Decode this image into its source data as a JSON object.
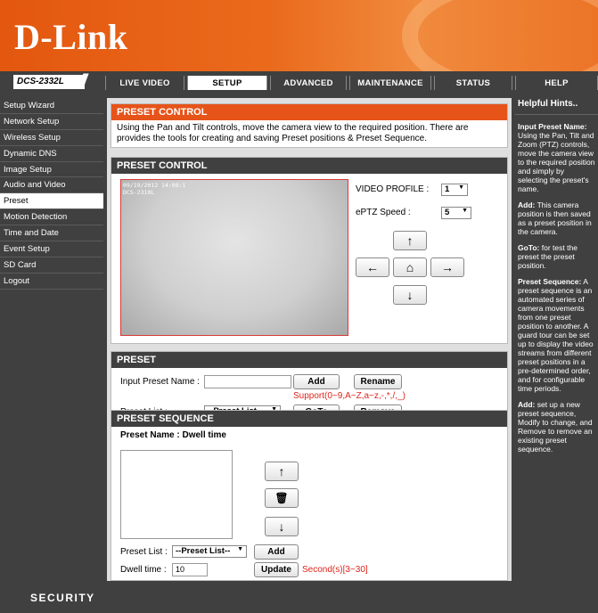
{
  "brand": {
    "logo": "D-Link",
    "model": "DCS-2332L",
    "footer": "SECURITY"
  },
  "nav": {
    "tabs": [
      "LIVE VIDEO",
      "SETUP",
      "ADVANCED",
      "MAINTENANCE",
      "STATUS",
      "HELP"
    ],
    "active": "SETUP"
  },
  "sidebar": {
    "items": [
      "Setup Wizard",
      "Network Setup",
      "Wireless Setup",
      "Dynamic DNS",
      "Image Setup",
      "Audio and Video",
      "Preset",
      "Motion Detection",
      "Time and Date",
      "Event Setup",
      "SD Card",
      "Logout"
    ],
    "active": "Preset"
  },
  "intro": {
    "title": "PRESET CONTROL",
    "text": "Using the Pan and Tilt controls, move the camera view to the required position. There are provides the tools for creating and saving Preset positions & Preset Sequence."
  },
  "control": {
    "title": "PRESET CONTROL",
    "timestamp": "09/19/2012 14:08:1\nDCS-2310L",
    "video_profile_label": "VIDEO PROFILE :",
    "video_profile_value": "1",
    "eptz_label": "ePTZ Speed :",
    "eptz_value": "5",
    "arrows": {
      "up": "↑",
      "left": "←",
      "home": "⌂",
      "right": "→",
      "down": "↓"
    }
  },
  "preset": {
    "title": "PRESET",
    "name_label": "Input Preset Name :",
    "name_value": "",
    "add": "Add",
    "rename": "Rename",
    "support": "Support(0~9,A~Z,a~z,-,*,/,_)",
    "list_label": "Preset List :",
    "list_value": "--Preset List--",
    "goto": "GoTo",
    "remove": "Remove"
  },
  "sequence": {
    "title": "PRESET SEQUENCE",
    "header": "Preset Name : Dwell time",
    "list_label": "Preset List :",
    "list_value": "--Preset List--",
    "add": "Add",
    "dwell_label": "Dwell time :",
    "dwell_value": "10",
    "update": "Update",
    "dwell_hint": "Second(s)[3~30]",
    "btn_up": "↑",
    "btn_delete": "🗑",
    "btn_down": "↓"
  },
  "help": {
    "title": "Helpful Hints..",
    "h1": "Input Preset Name:",
    "t1": "Using the Pan, Tilt and Zoom (PTZ) controls, move the camera view to the required position and simply by selecting the preset's name.",
    "h2": "Add:",
    "t2": "This camera position is then saved as a preset position in the camera.",
    "h3": "GoTo:",
    "t3": "for test the preset the preset position.",
    "h4": "Preset Sequence:",
    "t4": "A preset sequence is an automated series of camera movements from one preset position to another. A guard tour can be set up to display the video streams from different preset positions in a pre-determined order, and for configurable time periods.",
    "h5": "Add:",
    "t5": "set up a new preset sequence, Modify to change, and Remove to remove an existing preset sequence."
  }
}
